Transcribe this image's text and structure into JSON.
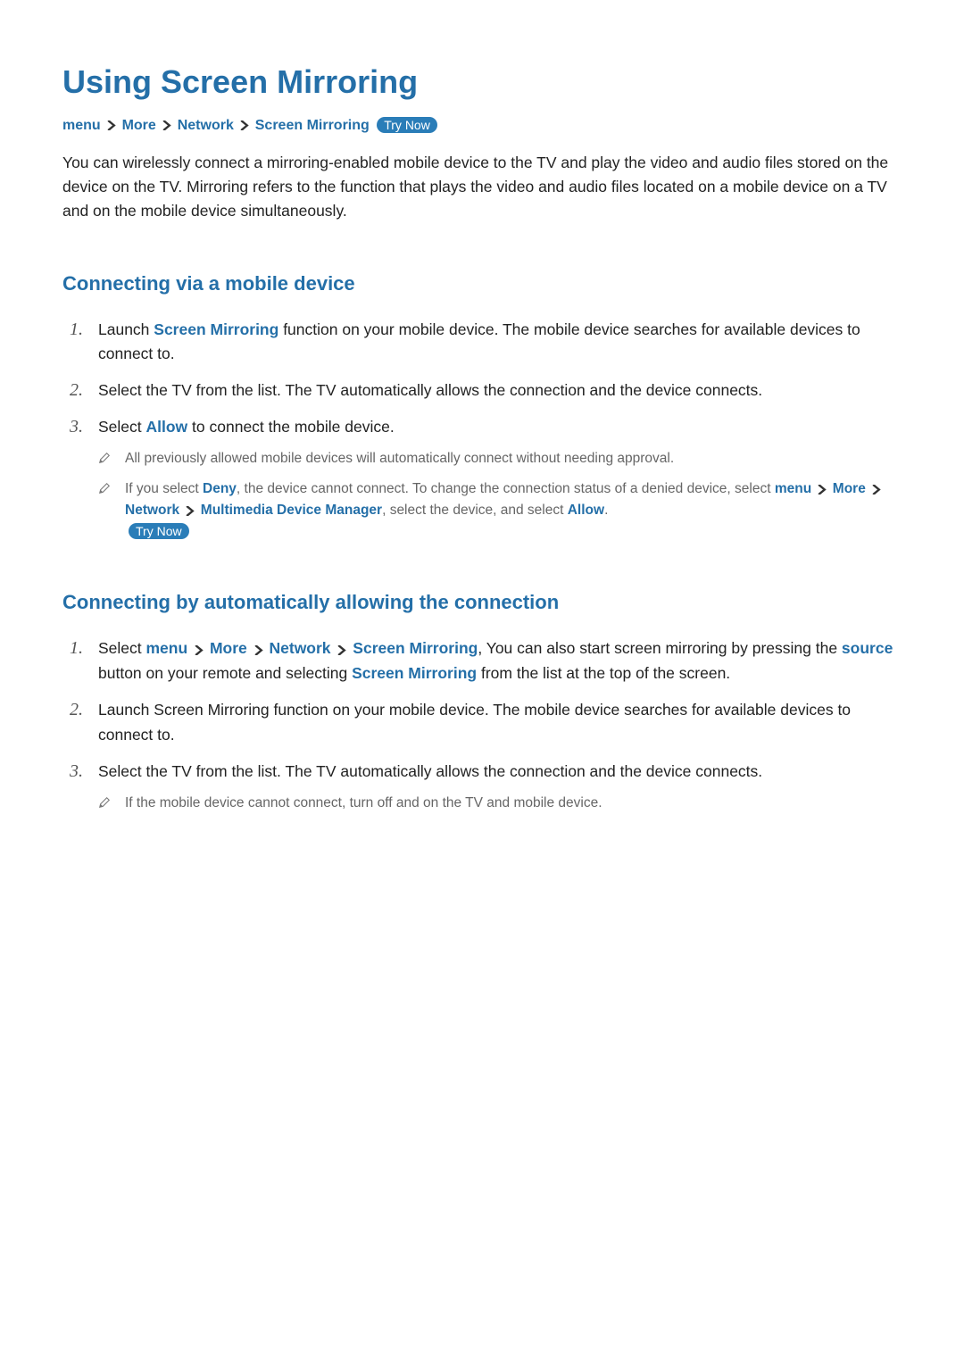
{
  "title": "Using Screen Mirroring",
  "breadcrumb": {
    "items": [
      "menu",
      "More",
      "Network",
      "Screen Mirroring"
    ],
    "trynow": "Try Now"
  },
  "intro": "You can wirelessly connect a mirroring-enabled mobile device to the TV and play the video and audio files stored on the device on the TV. Mirroring refers to the function that plays the video and audio files located on a mobile device on a TV and on the mobile device simultaneously.",
  "section1": {
    "heading": "Connecting via a mobile device",
    "step1_a": "Launch ",
    "step1_kw": "Screen Mirroring",
    "step1_b": " function on your mobile device. The mobile device searches for available devices to connect to.",
    "step2": "Select the TV from the list. The TV automatically allows the connection and the device connects.",
    "step3_a": "Select ",
    "step3_kw": "Allow",
    "step3_b": " to connect the mobile device.",
    "note1": "All previously allowed mobile devices will automatically connect without needing approval.",
    "note2_a": "If you select ",
    "note2_deny": "Deny",
    "note2_b": ", the device cannot connect. To change the connection status of a denied device, select ",
    "note2_path": [
      "menu",
      "More",
      "Network",
      "Multimedia Device Manager"
    ],
    "note2_c": ", select the device, and select ",
    "note2_allow": "Allow",
    "note2_d": ". ",
    "note2_trynow": "Try Now"
  },
  "section2": {
    "heading": "Connecting by automatically allowing the connection",
    "step1_a": "Select ",
    "step1_path": [
      "menu",
      "More",
      "Network",
      "Screen Mirroring"
    ],
    "step1_b": ", You can also start screen mirroring by pressing the ",
    "step1_source": "source",
    "step1_c": " button on your remote and selecting ",
    "step1_sm": "Screen Mirroring",
    "step1_d": " from the list at the top of the screen.",
    "step2": "Launch Screen Mirroring function on your mobile device. The mobile device searches for available devices to connect to.",
    "step3": "Select the TV from the list. The TV automatically allows the connection and the device connects.",
    "note1": "If the mobile device cannot connect, turn off and on the TV and mobile device."
  }
}
